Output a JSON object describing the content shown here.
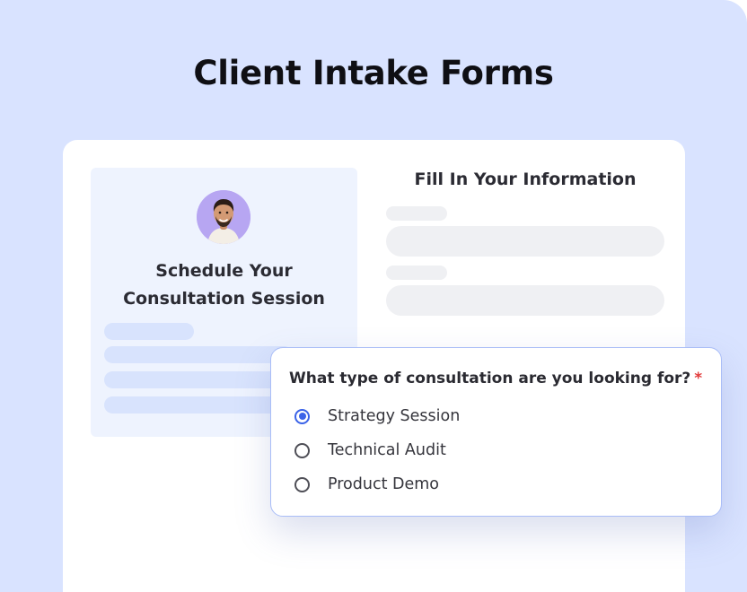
{
  "title": "Client Intake Forms",
  "left_panel": {
    "heading_line1": "Schedule Your",
    "heading_line2": "Consultation Session"
  },
  "right_panel": {
    "title": "Fill In Your Information"
  },
  "popup": {
    "question": "What type of consultation are you looking for?",
    "required_marker": "*",
    "options": [
      {
        "label": "Strategy Session",
        "selected": true
      },
      {
        "label": "Technical Audit",
        "selected": false
      },
      {
        "label": "Product Demo",
        "selected": false
      }
    ]
  },
  "colors": {
    "background": "#d9e3ff",
    "accent": "#3b63e8",
    "required": "#e23b3b"
  }
}
